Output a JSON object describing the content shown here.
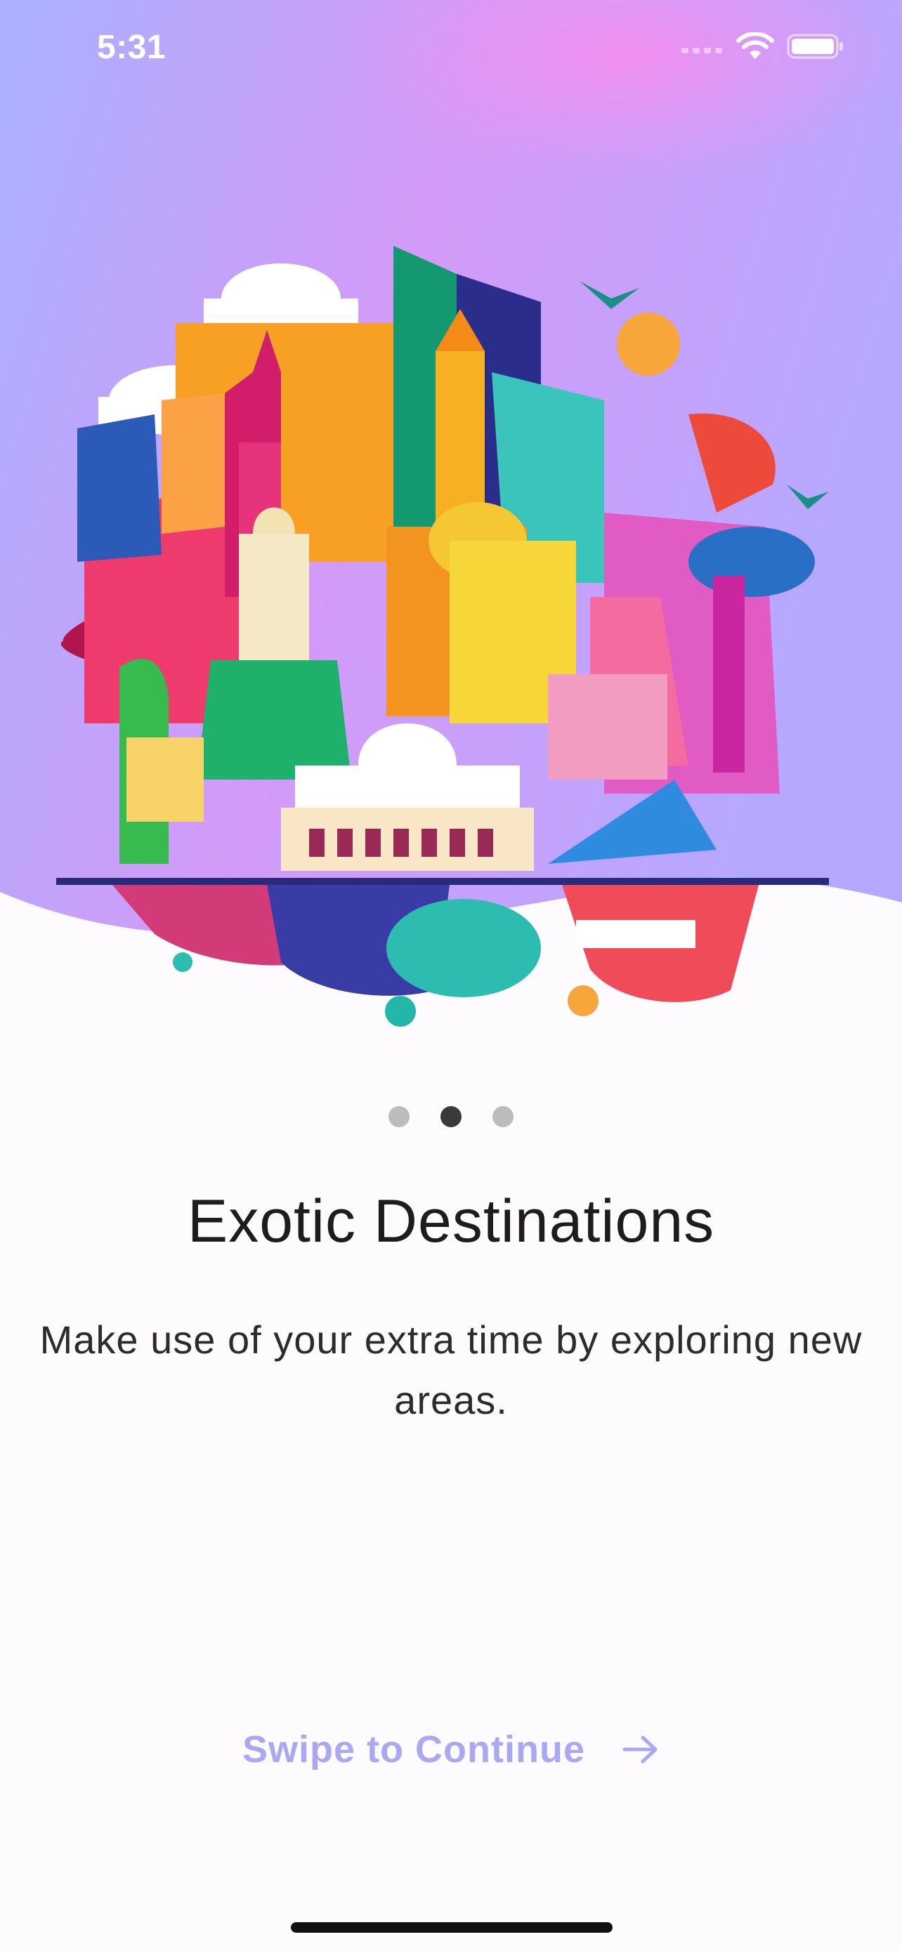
{
  "status_bar": {
    "time": "5:31",
    "signal_icon": "cellular-signal-icon",
    "wifi_icon": "wifi-icon",
    "battery_icon": "battery-icon"
  },
  "onboarding": {
    "illustration_icon": "city-landmarks-illustration",
    "pages_total": 3,
    "current_page": 2,
    "title": "Exotic Destinations",
    "subtitle": "Make use of your extra time by exploring new areas.",
    "continue_label": "Swipe to Continue",
    "continue_icon": "arrow-right-icon"
  },
  "colors": {
    "background": "#fefbfe",
    "gradient_start": "#a7b1ff",
    "gradient_mid": "#f08ff0",
    "gradient_end": "#b6a4ff",
    "cta": "#a9a8f3",
    "dot_active": "#3a3a3a",
    "dot_inactive": "#bcbcbc"
  }
}
